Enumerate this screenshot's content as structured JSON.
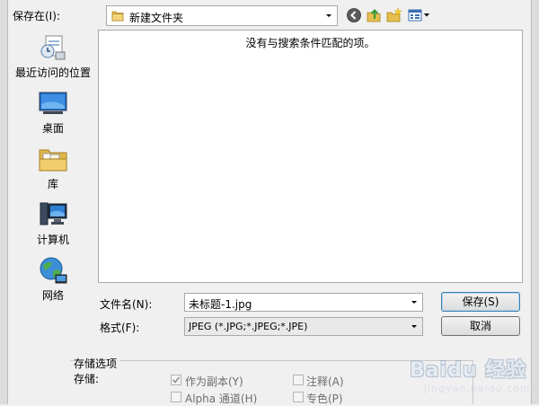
{
  "toolbar": {
    "save_in_label": "保存在(I):",
    "current_folder": "新建文件夹"
  },
  "places": [
    {
      "label": "最近访问的位置",
      "icon": "recent-places-icon"
    },
    {
      "label": "桌面",
      "icon": "desktop-icon"
    },
    {
      "label": "库",
      "icon": "libraries-icon"
    },
    {
      "label": "计算机",
      "icon": "computer-icon"
    },
    {
      "label": "网络",
      "icon": "network-icon"
    }
  ],
  "file_list": {
    "empty_message": "没有与搜索条件匹配的项。"
  },
  "filename": {
    "label": "文件名(N):",
    "value": "未标题-1.jpg"
  },
  "format": {
    "label": "格式(F):",
    "value": "JPEG (*.JPG;*.JPEG;*.JPE)"
  },
  "buttons": {
    "save": "保存(S)",
    "cancel": "取消"
  },
  "save_options": {
    "title": "存储选项",
    "subtitle": "存储:",
    "checkboxes": [
      {
        "label": "作为副本(Y)",
        "checked": true,
        "enabled": false
      },
      {
        "label": "注释(A)",
        "checked": false,
        "enabled": false
      },
      {
        "label": "Alpha 通道(H)",
        "checked": false,
        "enabled": false
      },
      {
        "label": "专色(P)",
        "checked": false,
        "enabled": false
      }
    ]
  },
  "watermark": {
    "brand": "Baidu 经验",
    "url": "jingyan.baidu.com"
  },
  "colors": {
    "dialog_bg": "#f0f0f0",
    "field_border": "#a9a9a9",
    "default_button_border": "#3c7fb1"
  }
}
